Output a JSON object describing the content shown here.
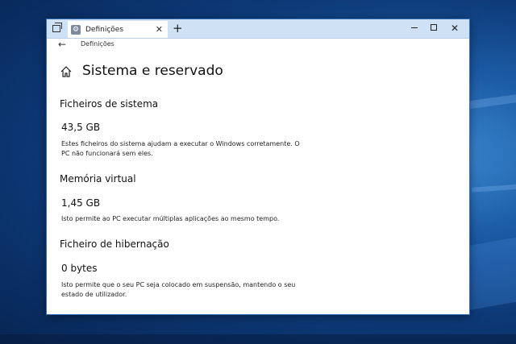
{
  "tab": {
    "label": "Definições"
  },
  "breadcrumb": "Definições",
  "page_title": "Sistema e reservado",
  "sections": [
    {
      "title": "Ficheiros de sistema",
      "size": "43,5 GB",
      "description": "Estes ficheiros do sistema ajudam a executar o Windows corretamente. O PC não funcionará sem eles."
    },
    {
      "title": "Memória virtual",
      "size": "1,45 GB",
      "description": "Isto permite ao PC executar múltiplas aplicações ao mesmo tempo."
    },
    {
      "title": "Ficheiro de hibernação",
      "size": "0 bytes",
      "description": "Isto permite que o seu PC seja colocado em suspensão, mantendo o seu estado de utilizador."
    }
  ],
  "colors": {
    "titlebar": "#cfe1f5",
    "desktop": "#0d3a78",
    "accent": "#2f6fb8"
  },
  "icons": {
    "back": "back-arrow-icon",
    "home": "home-icon",
    "gear": "gear-icon",
    "close": "close-icon",
    "new_tab": "plus-icon"
  }
}
